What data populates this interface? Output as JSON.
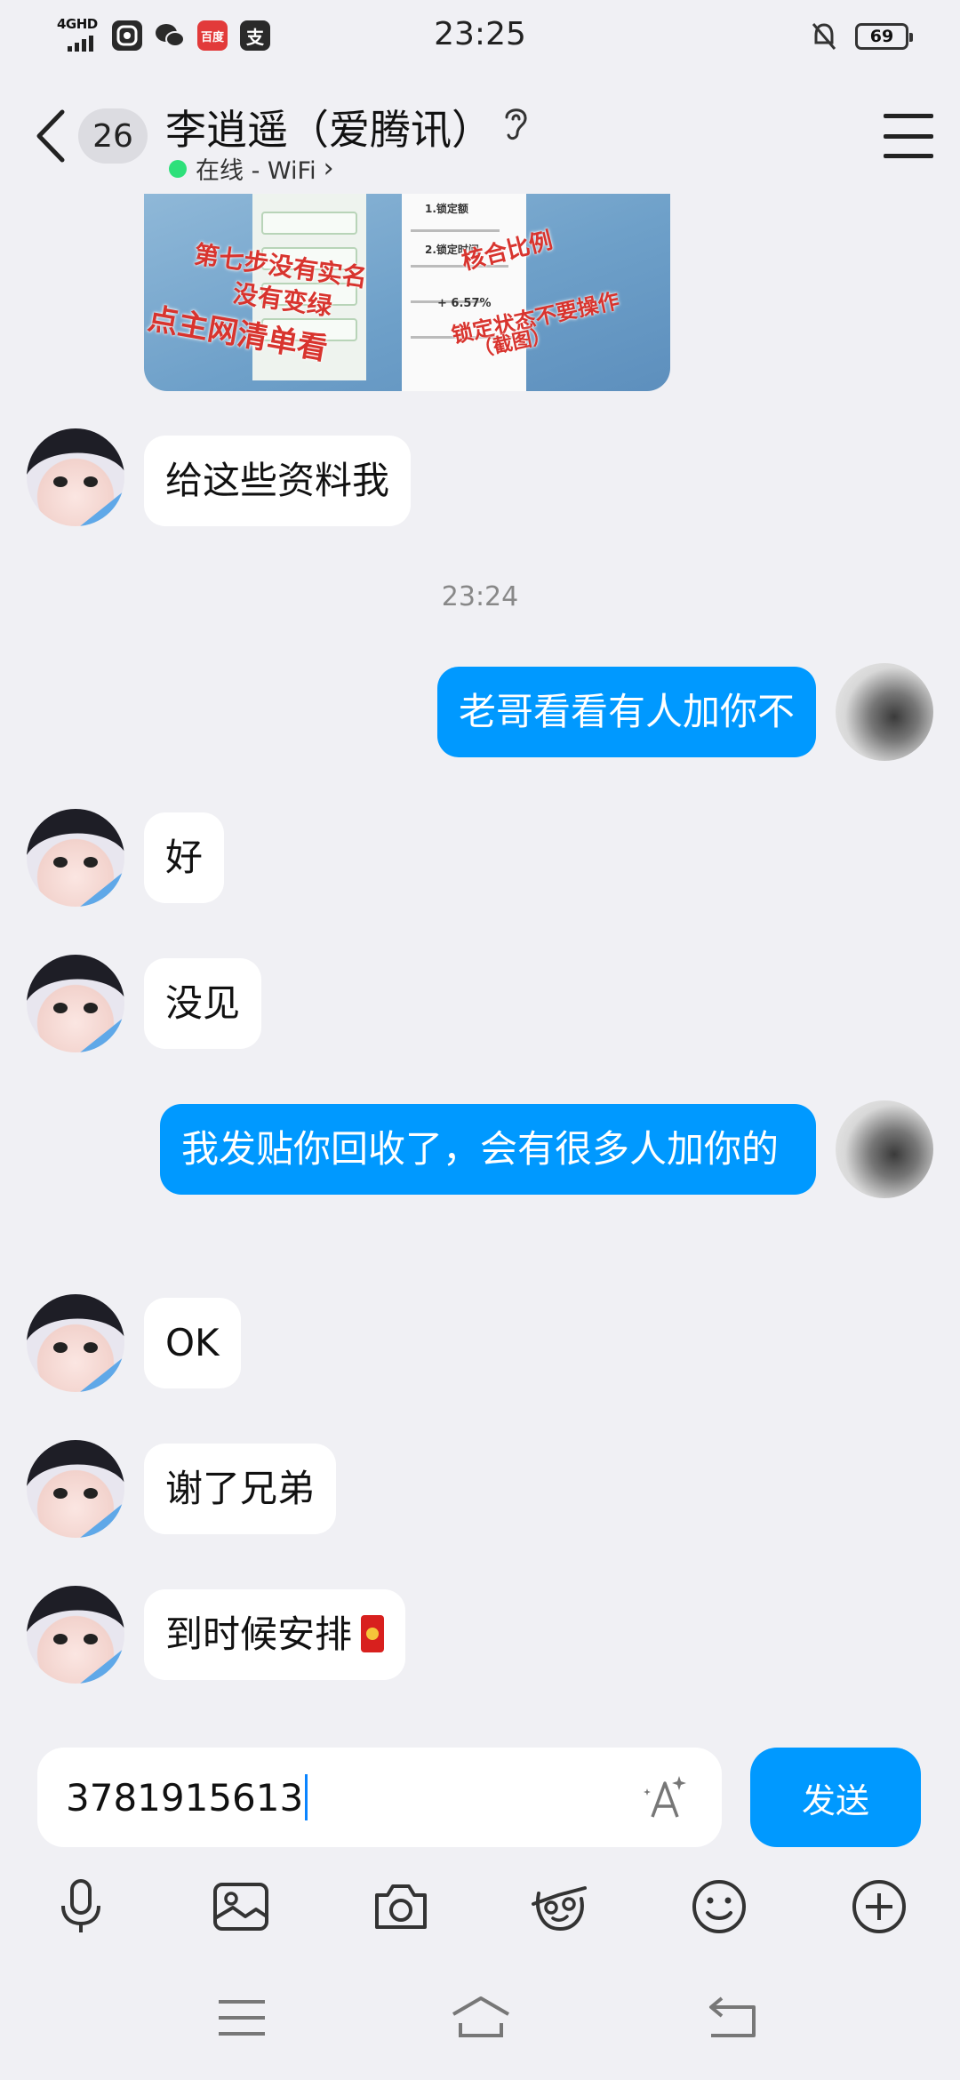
{
  "status_bar": {
    "network": "4GHD",
    "time": "23:25",
    "battery": "69",
    "app_icons": [
      "app-icon",
      "wechat-icon",
      "red-app-icon",
      "alipay-icon"
    ],
    "red_app_label": "百度",
    "alipay_label": "支"
  },
  "header": {
    "back_count": "26",
    "contact_name": "李逍遥（爱腾讯）",
    "status_text": "在线 - WiFi",
    "status_chevron": "›"
  },
  "image_message": {
    "labels": [
      "第七步没有实名",
      "没有变绿",
      "点主网清单看",
      "核合比例",
      "锁定状态不要操作",
      "（截图）",
      "1.锁定额",
      "2.锁定时间",
      "+ 6.57%"
    ]
  },
  "messages": [
    {
      "id": "m1",
      "side": "in",
      "text": "给这些资料我"
    },
    {
      "id": "ts",
      "type": "timestamp",
      "text": "23:24"
    },
    {
      "id": "m2",
      "side": "out",
      "text": "老哥看看有人加你不"
    },
    {
      "id": "m3",
      "side": "in",
      "text": "好"
    },
    {
      "id": "m4",
      "side": "in",
      "text": "没见"
    },
    {
      "id": "m5",
      "side": "out",
      "text": "我发贴你回收了，会有很多人加你的"
    },
    {
      "id": "m6",
      "side": "in",
      "text": "OK"
    },
    {
      "id": "m7",
      "side": "in",
      "text": "谢了兄弟"
    },
    {
      "id": "m8",
      "side": "in",
      "text": "到时候安排"
    }
  ],
  "input": {
    "value": "3781915613",
    "send_label": "发送"
  },
  "toolbar": [
    "microphone-icon",
    "image-icon",
    "camera-icon",
    "sticker-icon",
    "emoji-icon",
    "plus-icon"
  ],
  "nav": [
    "recent-apps-icon",
    "home-icon",
    "back-icon"
  ],
  "colors": {
    "accent": "#0099ff",
    "background": "#f0f0f4",
    "online": "#2ee07a"
  }
}
